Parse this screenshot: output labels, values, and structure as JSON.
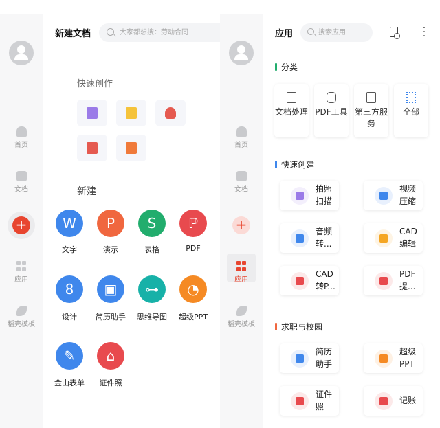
{
  "left": {
    "sidebar": {
      "items": [
        {
          "label": "首页",
          "icon": "home-icon"
        },
        {
          "label": "文档",
          "icon": "document-icon"
        },
        {
          "label": "应用",
          "icon": "apps-icon"
        },
        {
          "label": "稻壳模板",
          "icon": "docer-leaf-icon"
        }
      ],
      "plus": "+"
    },
    "title": "新建文档",
    "search_placeholder": "大家都想搜：劳动合同",
    "quick_title": "快速创作",
    "quick_items": [
      {
        "icon": "scan-icon",
        "color": "#9b7be8"
      },
      {
        "icon": "new-file-icon",
        "color": "#f5c33b"
      },
      {
        "icon": "person-icon",
        "color": "#e55a50"
      },
      {
        "icon": "book-search-icon",
        "color": "#e55a50"
      },
      {
        "icon": "image-doc-icon",
        "color": "#f07a3a"
      }
    ],
    "new_title": "新建",
    "new_items": [
      {
        "label": "文字",
        "glyph": "W",
        "color": "#3f87ec"
      },
      {
        "label": "演示",
        "glyph": "P",
        "color": "#f0673f"
      },
      {
        "label": "表格",
        "glyph": "S",
        "color": "#22ad6d"
      },
      {
        "label": "PDF",
        "glyph": "ℙ",
        "color": "#e84a4e"
      },
      {
        "label": "设计",
        "glyph": "8",
        "color": "#3f87ec"
      },
      {
        "label": "简历助手",
        "glyph": "▣",
        "color": "#3f87ec"
      },
      {
        "label": "思维导图",
        "glyph": "⊶",
        "color": "#17b1a8"
      },
      {
        "label": "超级PPT",
        "glyph": "◔",
        "color": "#f58a24"
      },
      {
        "label": "金山表单",
        "glyph": "✎",
        "color": "#3f87ec"
      },
      {
        "label": "证件照",
        "glyph": "⌂",
        "color": "#e84a4e"
      }
    ]
  },
  "right": {
    "sidebar": {
      "items": [
        {
          "label": "首页"
        },
        {
          "label": "文档"
        },
        {
          "label": "应用",
          "active": true
        },
        {
          "label": "稻壳模板"
        }
      ],
      "plus": "+",
      "accent": "#e8452f"
    },
    "title": "应用",
    "search_placeholder": "搜索应用",
    "sections": {
      "category": {
        "title": "分类",
        "color": "#22ad6d",
        "items": [
          "文档处理",
          "PDF工具",
          "第三方服务",
          "全部"
        ]
      },
      "quick": {
        "title": "快速创建",
        "color": "#3f87ec",
        "items": [
          {
            "label": "拍照扫描",
            "color": "#9b7be8"
          },
          {
            "label": "视频压缩",
            "color": "#3f87ec"
          },
          {
            "label": "音频转...",
            "color": "#3f87ec"
          },
          {
            "label": "CAD编辑",
            "color": "#f5a623"
          },
          {
            "label": "CAD转P...",
            "color": "#e84a4e"
          },
          {
            "label": "PDF提...",
            "color": "#e84a4e"
          }
        ]
      },
      "career": {
        "title": "求职与校园",
        "color": "#f0673f",
        "items": [
          {
            "label": "简历助手",
            "color": "#3f87ec"
          },
          {
            "label": "超级PPT",
            "color": "#f58a24"
          },
          {
            "label": "证件照",
            "color": "#e84a4e"
          },
          {
            "label": "记账",
            "color": "#e84a4e"
          }
        ]
      }
    }
  }
}
